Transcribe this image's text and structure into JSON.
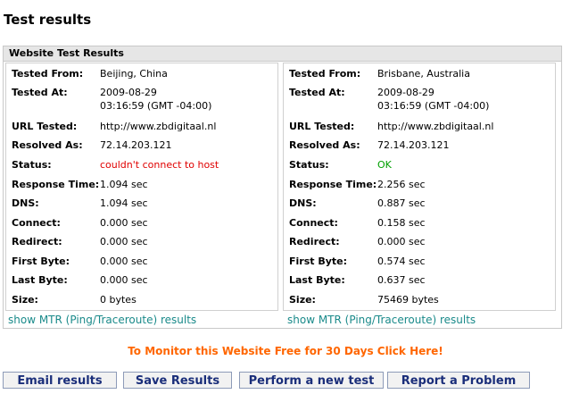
{
  "page": {
    "title": "Test results"
  },
  "panel": {
    "title": "Website Test Results"
  },
  "labels": {
    "tested_from": "Tested From:",
    "tested_at": "Tested At:",
    "url_tested": "URL Tested:",
    "resolved_as": "Resolved As:",
    "status": "Status:",
    "response_time": "Response Time:",
    "dns": "DNS:",
    "connect": "Connect:",
    "redirect": "Redirect:",
    "first_byte": "First Byte:",
    "last_byte": "Last Byte:",
    "size": "Size:"
  },
  "locations": [
    {
      "tested_from": "Beijing, China",
      "tested_at_date": "2009-08-29",
      "tested_at_time": "03:16:59 (GMT -04:00)",
      "url_tested": "http://www.zbdigitaal.nl",
      "resolved_as": "72.14.203.121",
      "status": "couldn't connect to host",
      "status_color": "#e00000",
      "response_time": "1.094 sec",
      "dns": "1.094 sec",
      "connect": "0.000 sec",
      "redirect": "0.000 sec",
      "first_byte": "0.000 sec",
      "last_byte": "0.000 sec",
      "size": "0 bytes",
      "mtr_link": "show MTR (Ping/Traceroute) results"
    },
    {
      "tested_from": "Brisbane, Australia",
      "tested_at_date": "2009-08-29",
      "tested_at_time": "03:16:59 (GMT -04:00)",
      "url_tested": "http://www.zbdigitaal.nl",
      "resolved_as": "72.14.203.121",
      "status": "OK",
      "status_color": "#00a000",
      "response_time": "2.256 sec",
      "dns": "0.887 sec",
      "connect": "0.158 sec",
      "redirect": "0.000 sec",
      "first_byte": "0.574 sec",
      "last_byte": "0.637 sec",
      "size": "75469 bytes",
      "mtr_link": "show MTR (Ping/Traceroute) results"
    }
  ],
  "promo": {
    "text": "To Monitor this Website Free for 30 Days Click Here!",
    "color": "#ff6600"
  },
  "buttons": {
    "email": "Email results",
    "save": "Save Results",
    "new_test": "Perform a new test",
    "report": "Report a Problem"
  }
}
